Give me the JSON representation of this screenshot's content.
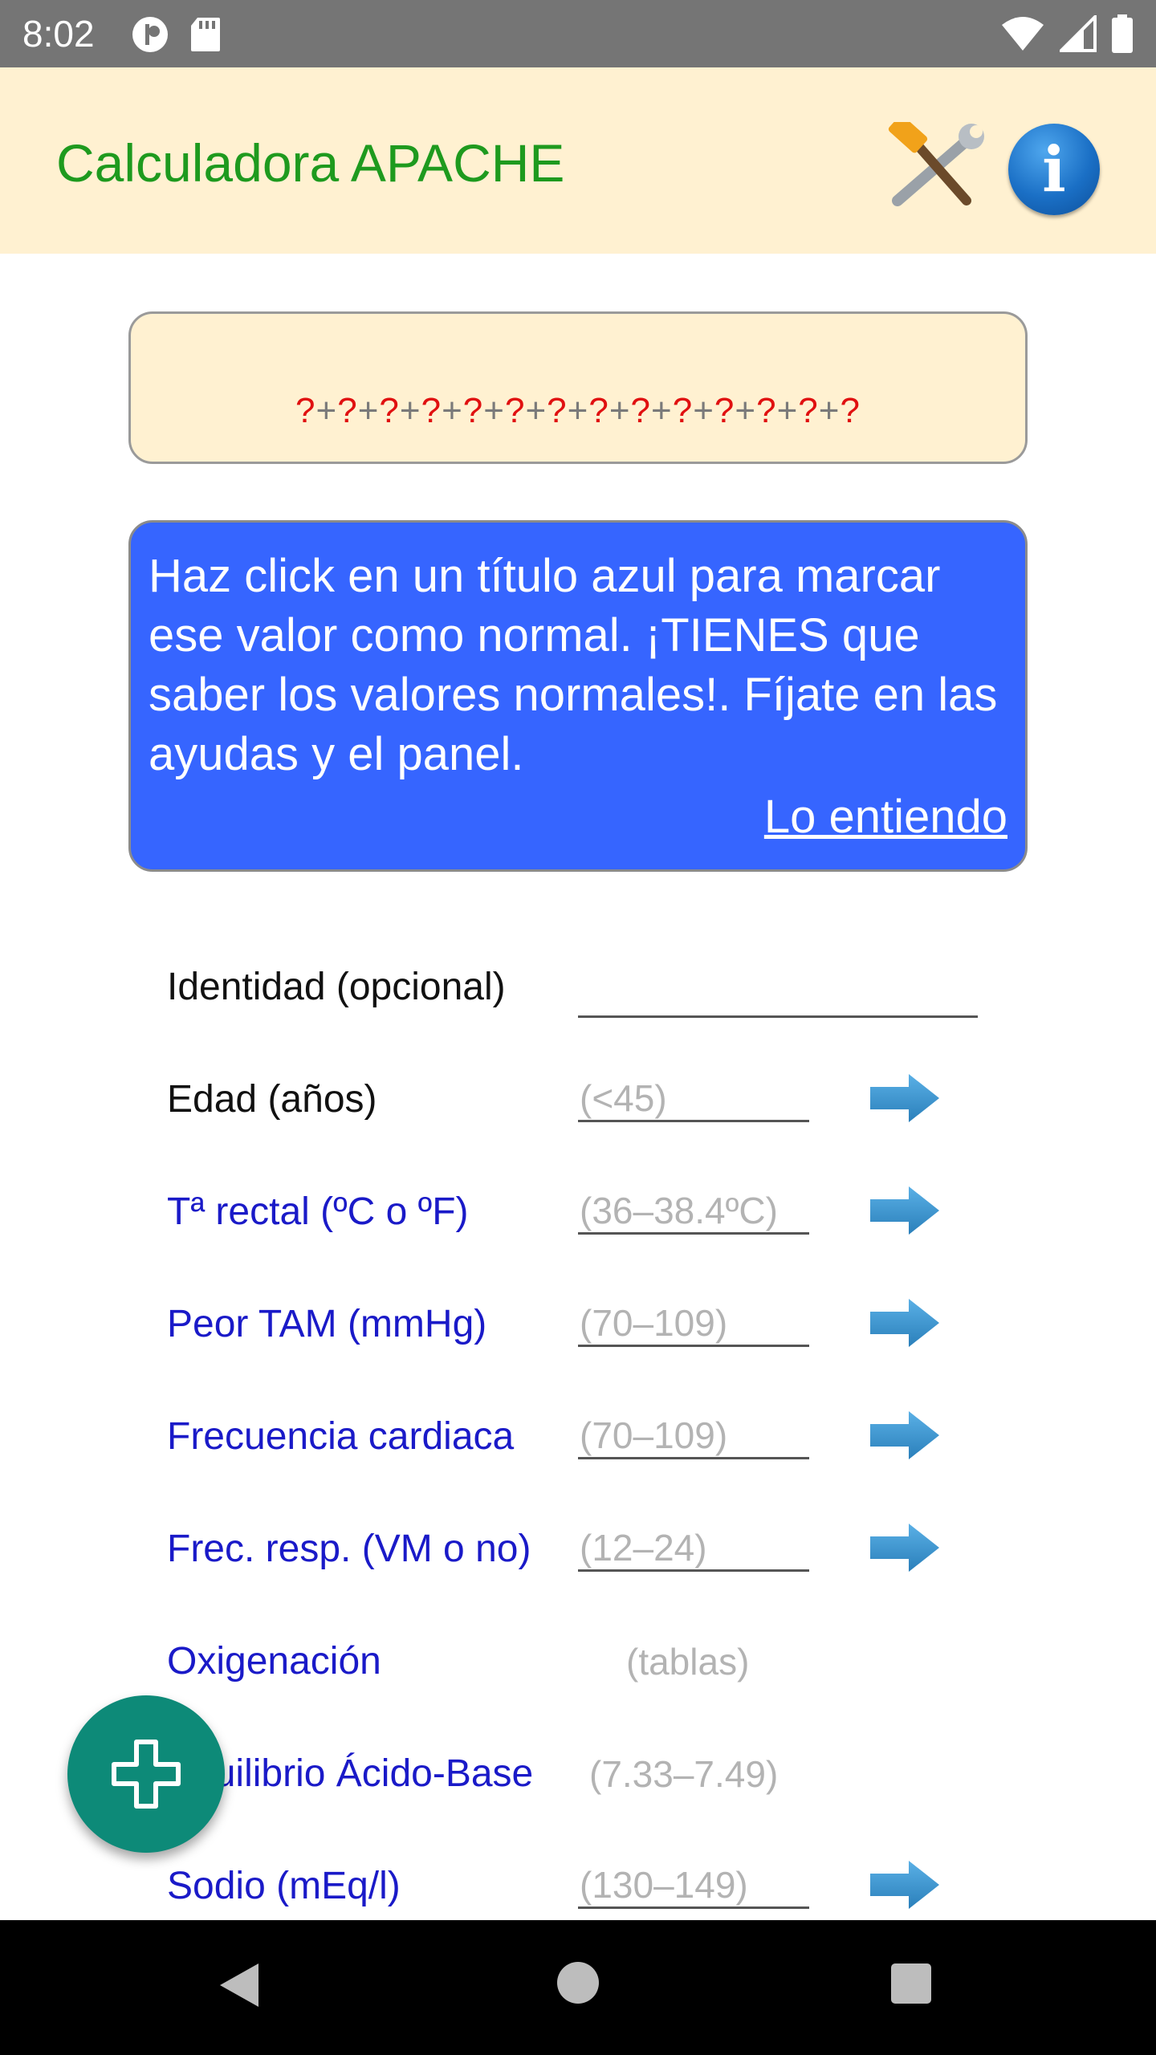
{
  "status_bar": {
    "time": "8:02",
    "icons": [
      "quota-icon",
      "sd-card-icon",
      "wifi-icon",
      "signal-icon",
      "battery-icon"
    ]
  },
  "app_bar": {
    "title": "Calculadora APACHE",
    "title_color": "#1e9a1e",
    "background": "#fff1d1",
    "tools_icon": "tools-icon",
    "info_icon": "info-icon",
    "info_glyph": "i"
  },
  "score": {
    "question": "?",
    "plus": "+"
  },
  "hint": {
    "text": "Haz click en un título azul para marcar ese valor como normal. ¡TIENES que saber los valores normales!. Fíjate en las ayudas y el panel.",
    "link": "Lo entiendo",
    "background": "#3665ff"
  },
  "form": {
    "identity": {
      "label": "Identidad (opcional)",
      "value": ""
    },
    "rows": [
      {
        "label": "Edad (años)",
        "placeholder": "(<45)"
      },
      {
        "label": "Tª rectal (ºC o ºF)",
        "placeholder": "(36–38.4ºC)"
      },
      {
        "label": "Peor TAM (mmHg)",
        "placeholder": "(70–109)"
      },
      {
        "label": "Frecuencia cardiaca",
        "placeholder": "(70–109)"
      },
      {
        "label": "Frec. resp. (VM o no)",
        "placeholder": "(12–24)"
      },
      {
        "label": "Oxigenación",
        "placeholder": "(tablas)"
      },
      {
        "label": "Equilibrio Ácido-Base",
        "placeholder": "(7.33–7.49)"
      },
      {
        "label": "Sodio (mEq/l)",
        "placeholder": "(130–149)"
      }
    ],
    "label_color_blue": "#1a1ac8",
    "arrow_icon": "arrow-right-icon"
  },
  "fab": {
    "icon": "plus-icon",
    "color": "#0d8a78"
  },
  "nav_bar": {
    "icons": [
      "back-icon",
      "home-icon",
      "recents-icon"
    ]
  }
}
